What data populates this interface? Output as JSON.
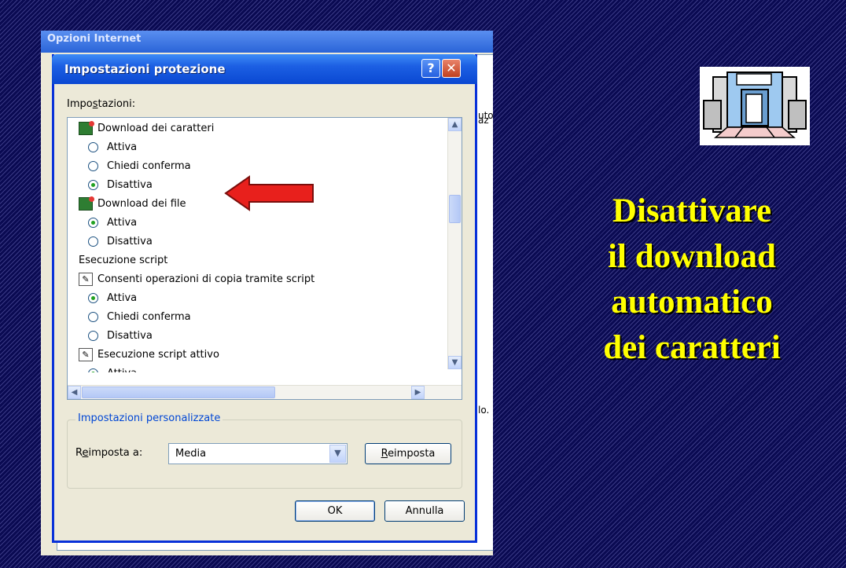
{
  "background_window": {
    "title": "Opzioni Internet",
    "fragments": [
      "uto",
      "az",
      "lo."
    ]
  },
  "dialog": {
    "title": "Impostazioni protezione",
    "help_label": "?",
    "close_label": "✕",
    "settings_label_pre": "Impo",
    "settings_label_u": "s",
    "settings_label_post": "tazioni:",
    "items": {
      "dl_fonts": "Download dei caratteri",
      "dl_fonts_opt1": "Attiva",
      "dl_fonts_opt2": "Chiedi conferma",
      "dl_fonts_opt3": "Disattiva",
      "dl_files": "Download dei file",
      "dl_files_opt1": "Attiva",
      "dl_files_opt2": "Disattiva",
      "script_cat": "Esecuzione script",
      "copy_script": "Consenti operazioni di copia tramite script",
      "copy_opt1": "Attiva",
      "copy_opt2": "Chiedi conferma",
      "copy_opt3": "Disattiva",
      "active_script": "Esecuzione script attivo",
      "active_opt1": "Attiva"
    },
    "custom": {
      "group_label": "Impostazioni personalizzate",
      "reset_label_pre": "R",
      "reset_label_u": "e",
      "reset_label_post": "imposta a:",
      "combo_value": "Media",
      "reset_btn_u": "R",
      "reset_btn_post": "eimposta"
    },
    "ok_label": "OK",
    "cancel_label": "Annulla",
    "scroll": {
      "up": "▲",
      "down": "▼",
      "left": "◀",
      "right": "▶",
      "combo_arrow": "▼"
    }
  },
  "caption": {
    "line1": "Disattivare",
    "line2": "il download",
    "line3": "automatico",
    "line4": "dei caratteri"
  },
  "colors": {
    "caption": "#ffff00",
    "arrow": "#e8201c",
    "titlebar": "#0a48d2"
  }
}
